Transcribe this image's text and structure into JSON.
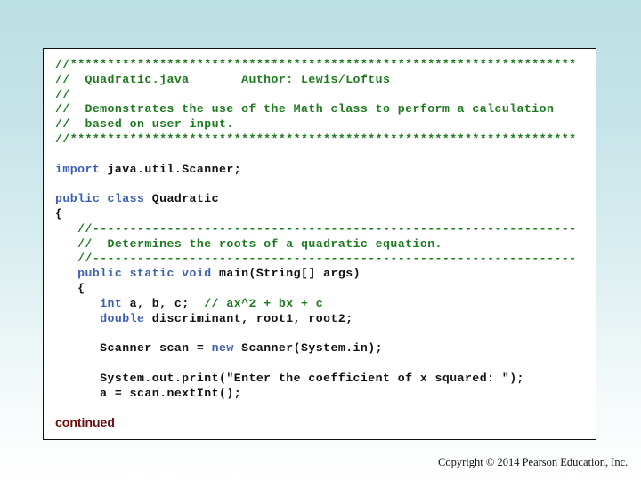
{
  "slide": {
    "background_top": "#bcdfe3",
    "background_bottom": "#ffffff"
  },
  "colors": {
    "comment": "#1e7a1e",
    "keyword": "#3d5fb3",
    "text": "#111111",
    "continued": "#6e0d0d"
  },
  "code_lines": [
    [
      {
        "t": "cm",
        "v": "//********************************************************************"
      }
    ],
    [
      {
        "t": "cm",
        "v": "//  Quadratic.java       Author: Lewis/Loftus"
      }
    ],
    [
      {
        "t": "cm",
        "v": "//"
      }
    ],
    [
      {
        "t": "cm",
        "v": "//  Demonstrates the use of the Math class to perform a calculation"
      }
    ],
    [
      {
        "t": "cm",
        "v": "//  based on user input."
      }
    ],
    [
      {
        "t": "cm",
        "v": "//********************************************************************"
      }
    ],
    [],
    [
      {
        "t": "kw",
        "v": "import"
      },
      {
        "t": "tx",
        "v": " java.util.Scanner;"
      }
    ],
    [],
    [
      {
        "t": "kw",
        "v": "public class"
      },
      {
        "t": "tx",
        "v": " Quadratic"
      }
    ],
    [
      {
        "t": "tx",
        "v": "{"
      }
    ],
    [
      {
        "t": "tx",
        "v": "   "
      },
      {
        "t": "cm",
        "v": "//-----------------------------------------------------------------"
      }
    ],
    [
      {
        "t": "tx",
        "v": "   "
      },
      {
        "t": "cm",
        "v": "//  Determines the roots of a quadratic equation."
      }
    ],
    [
      {
        "t": "tx",
        "v": "   "
      },
      {
        "t": "cm",
        "v": "//-----------------------------------------------------------------"
      }
    ],
    [
      {
        "t": "tx",
        "v": "   "
      },
      {
        "t": "kw",
        "v": "public static void"
      },
      {
        "t": "tx",
        "v": " main(String[] args)"
      }
    ],
    [
      {
        "t": "tx",
        "v": "   {"
      }
    ],
    [
      {
        "t": "tx",
        "v": "      "
      },
      {
        "t": "kw",
        "v": "int"
      },
      {
        "t": "tx",
        "v": " a, b, c;  "
      },
      {
        "t": "cm",
        "v": "// ax^2 + bx + c"
      }
    ],
    [
      {
        "t": "tx",
        "v": "      "
      },
      {
        "t": "kw",
        "v": "double"
      },
      {
        "t": "tx",
        "v": " discriminant, root1, root2;"
      }
    ],
    [],
    [
      {
        "t": "tx",
        "v": "      Scanner scan = "
      },
      {
        "t": "kw",
        "v": "new"
      },
      {
        "t": "tx",
        "v": " Scanner(System.in);"
      }
    ],
    [],
    [
      {
        "t": "tx",
        "v": "      System.out.print(\"Enter the coefficient of x squared: \");"
      }
    ],
    [
      {
        "t": "tx",
        "v": "      a = scan.nextInt();"
      }
    ]
  ],
  "continued_label": "continued",
  "copyright": "Copyright © 2014 Pearson Education, Inc."
}
